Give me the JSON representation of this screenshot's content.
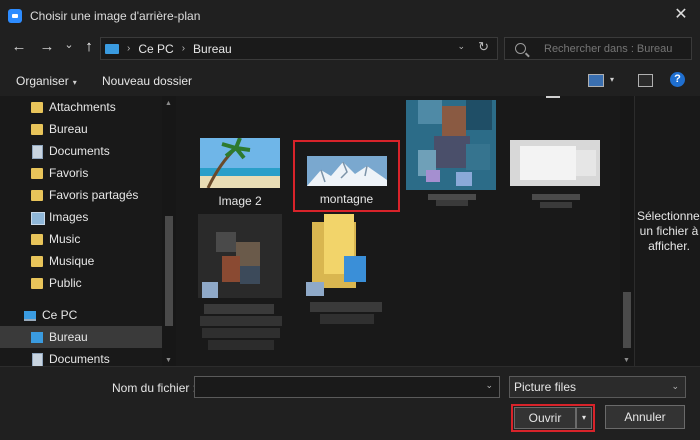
{
  "window": {
    "title": "Choisir une image d'arrière-plan",
    "close_glyph": "✕"
  },
  "nav": {
    "back_glyph": "←",
    "forward_glyph": "→",
    "recent_glyph": "⌄",
    "up_glyph": "↑",
    "breadcrumb": [
      "Ce PC",
      "Bureau"
    ],
    "crumb_sep": "›",
    "dropdown_glyph": "⌄",
    "refresh_glyph": "↻",
    "search_placeholder": "Rechercher dans : Bureau"
  },
  "toolbar": {
    "organiser_label": "Organiser",
    "organiser_caret": "▾",
    "new_folder_label": "Nouveau dossier",
    "view_caret": "▾",
    "help_glyph": "?"
  },
  "sidebar": {
    "items": [
      {
        "label": "Attachments",
        "icon": "folder-icon"
      },
      {
        "label": "Bureau",
        "icon": "folder-icon"
      },
      {
        "label": "Documents",
        "icon": "document-icon"
      },
      {
        "label": "Favoris",
        "icon": "folder-icon"
      },
      {
        "label": "Favoris partagés",
        "icon": "folder-icon"
      },
      {
        "label": "Images",
        "icon": "pictures-icon"
      },
      {
        "label": "Music",
        "icon": "folder-icon"
      },
      {
        "label": "Musique",
        "icon": "folder-icon"
      },
      {
        "label": "Public",
        "icon": "folder-icon"
      },
      {
        "label": "Ce PC",
        "icon": "computer-icon"
      },
      {
        "label": "Bureau",
        "icon": "desktop-icon",
        "selected": true
      },
      {
        "label": "Documents",
        "icon": "document-icon"
      }
    ],
    "scroll_up_glyph": "▲",
    "scroll_down_glyph": "▼"
  },
  "files": [
    {
      "label": "Image 2",
      "icon": "beach-thumbnail-icon"
    },
    {
      "label": "montagne",
      "icon": "mountain-thumbnail-icon",
      "highlighted": true
    },
    {
      "label": "",
      "icon": "blurred-thumbnail-icon"
    },
    {
      "label": "",
      "icon": "blurred-thumbnail-icon"
    },
    {
      "label": "",
      "icon": "blurred-thumbnail-icon"
    },
    {
      "label": "",
      "icon": "blurred-folder-thumbnail-icon"
    }
  ],
  "preview": {
    "message": "Sélectionnez un fichier à afficher."
  },
  "footer": {
    "filename_label": "Nom du fichier :",
    "filename_value": "",
    "filetype_value": "Picture files",
    "dropdown_glyph": "⌄",
    "open_label": "Ouvrir",
    "open_split_glyph": "▾",
    "cancel_label": "Annuler"
  },
  "colors": {
    "background": "#191919",
    "chrome": "#202020",
    "highlight_border": "#d8232a",
    "accent_blue": "#2d8cff",
    "folder_yellow": "#e8c45a"
  }
}
